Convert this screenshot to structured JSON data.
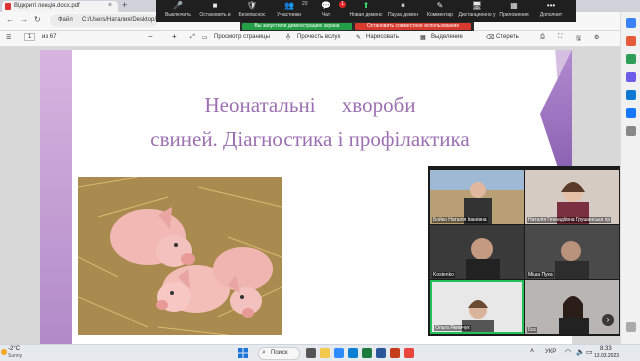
{
  "browser": {
    "tab_title": "Відкриті лекція.docx.pdf",
    "tab_close": "×",
    "new_tab": "+",
    "url_label": "Файл",
    "url_path": "C:/Users/Наталия/Desktop/...",
    "nav": {
      "back": "←",
      "forward": "→",
      "refresh": "↻"
    }
  },
  "zoom_toolbar": {
    "items": [
      {
        "icon": "🎤",
        "label": "Выключить"
      },
      {
        "icon": "■",
        "label": "Остановить в"
      },
      {
        "icon": "🛡",
        "label": "Безопаснос"
      },
      {
        "icon": "👥",
        "label": "Участники"
      },
      {
        "icon": "💬",
        "label": "Чат"
      },
      {
        "icon": "⬆",
        "label": "Новая демонс"
      },
      {
        "icon": "⏸",
        "label": "Пауза демон"
      },
      {
        "icon": "✎",
        "label": "Комментар"
      },
      {
        "icon": "🖥",
        "label": "Дистанционно у"
      },
      {
        "icon": "▦",
        "label": "Приложения"
      },
      {
        "icon": "•••",
        "label": "Дополнит"
      }
    ],
    "participants_count": "20",
    "chat_badge": "1",
    "share_status": "Вы запустили демонстрацию экрана",
    "stop_share": "Остановить совместное использование"
  },
  "pdf_toolbar": {
    "page_current": "1",
    "page_total": "из 67",
    "zoom_minus": "−",
    "zoom_plus": "+",
    "view_label": "Просмотр страницы",
    "read_aloud": "Прочесть вслух",
    "draw": "Нарисовать",
    "highlight": "Выделение",
    "erase": "Стереть"
  },
  "slide": {
    "title_line1": "Неонатальні     хвороби",
    "title_line2": "свиней. Діагностика і профілактика"
  },
  "video_tiles": [
    {
      "name": "Бойко Наталія Іванівна"
    },
    {
      "name": "Наталія Геннадіївна Грушанська пр"
    },
    {
      "name": "Kostenko"
    },
    {
      "name": "Міша Пука"
    },
    {
      "name": "Ольга Якимчук"
    },
    {
      "name": "Ilza"
    }
  ],
  "gallery_next": "›",
  "taskbar": {
    "temp": "-2°C",
    "condition": "Sunny",
    "search": "Поиск",
    "lang": "УКР",
    "time": "8:33",
    "date": "13.03.2023"
  },
  "colors": {
    "zoom_green": "#23a047",
    "zoom_red": "#d83b2e",
    "slide_title": "#9b6fb1"
  }
}
